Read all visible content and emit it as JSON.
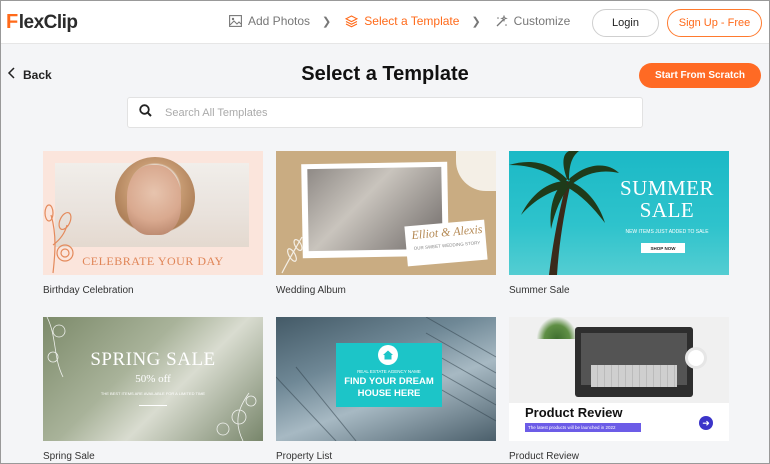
{
  "header": {
    "logo_text": "lexClip",
    "logo_mark": "F",
    "steps": [
      {
        "label": "Add Photos",
        "icon": "image-icon",
        "active": false
      },
      {
        "label": "Select a Template",
        "icon": "layers-icon",
        "active": true
      },
      {
        "label": "Customize",
        "icon": "magic-wand-icon",
        "active": false
      }
    ],
    "login_label": "Login",
    "signup_label": "Sign Up - Free"
  },
  "toolbar": {
    "back_label": "Back",
    "page_title": "Select a Template",
    "scratch_label": "Start From Scratch"
  },
  "search": {
    "placeholder": "Search All Templates",
    "value": ""
  },
  "templates": [
    {
      "name": "Birthday Celebration",
      "caption": "CELEBRATE YOUR DAY"
    },
    {
      "name": "Wedding Album",
      "caption_script": "Elliot & Alexis",
      "caption_sub": "OUR SWEET WEDDING STORY"
    },
    {
      "name": "Summer Sale",
      "title_line1": "SUMMER",
      "title_line2": "SALE",
      "sub": "NEW ITEMS JUST ADDED TO SALE",
      "button": "SHOP NOW"
    },
    {
      "name": "Spring Sale",
      "title": "SPRING SALE",
      "off": "50% off",
      "fine": "THE BEST ITEMS ARE AVAILABLE FOR A LIMITED TIME"
    },
    {
      "name": "Property List",
      "agency": "REAL ESTATE AGENCY NAME",
      "headline_line1": "FIND YOUR DREAM",
      "headline_line2": "HOUSE HERE"
    },
    {
      "name": "Product Review",
      "title": "Product Review",
      "sub": "The latest products will be launched in 2022"
    }
  ],
  "colors": {
    "accent": "#ff6a1a",
    "teal": "#1cc5c8",
    "purple": "#6c5ce7"
  }
}
